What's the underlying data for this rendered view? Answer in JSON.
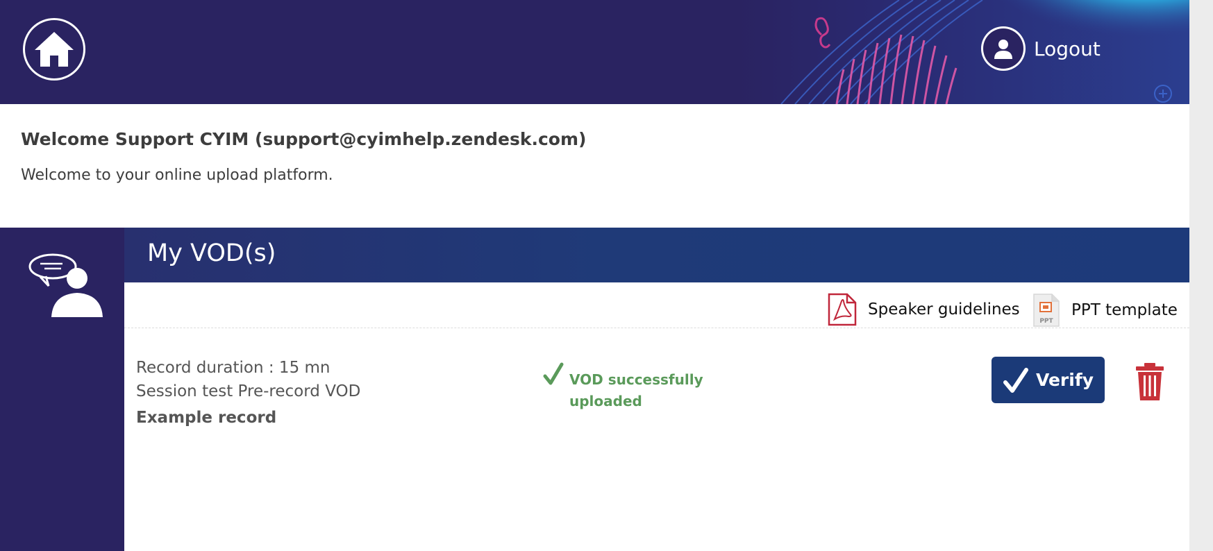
{
  "header": {
    "home_icon": "home-icon",
    "logout_label": "Logout",
    "logout_icon": "user-icon"
  },
  "welcome": {
    "title": "Welcome Support CYIM (support@cyimhelp.zendesk.com)",
    "subtitle": "Welcome to your online upload platform."
  },
  "section": {
    "title": "My VOD(s)",
    "icon": "speaker-chat-icon"
  },
  "resources": {
    "speaker_guidelines_label": "Speaker guidelines",
    "speaker_guidelines_icon": "pdf-icon",
    "ppt_template_label": "PPT template",
    "ppt_template_icon": "ppt-file-icon",
    "ppt_badge": "PPT"
  },
  "record": {
    "duration": "Record duration : 15 mn",
    "session": "Session test Pre-record VOD",
    "name": "Example record",
    "status": "VOD successfully uploaded",
    "verify_label": "Verify",
    "delete_icon": "trash-icon"
  },
  "colors": {
    "header_bg": "#2a2361",
    "section_head": "#1d3a7a",
    "success": "#5a9a5a",
    "verify_bg": "#1b3a78",
    "delete": "#c8323a",
    "pdf": "#c0263a"
  }
}
